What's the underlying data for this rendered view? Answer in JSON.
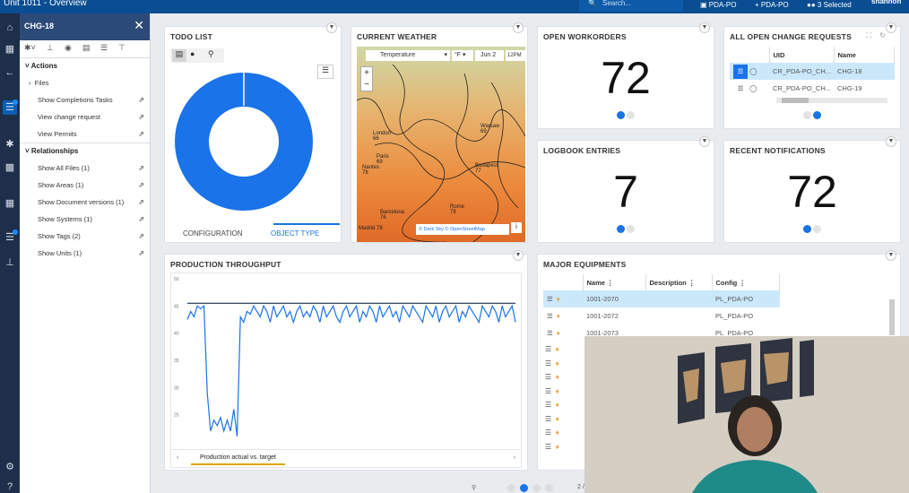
{
  "topbar": {
    "title": "Unit 1011 - Overview",
    "search_placeholder": "Search...",
    "item1": "PDA-PO",
    "item2": "PDA-PO",
    "selected": "3 Selected",
    "user": "shannon"
  },
  "side": {
    "title": "CHG-18",
    "sections": {
      "actions": "Actions",
      "relationships": "Relationships"
    },
    "actions": [
      "Files",
      "Show Completions Tasks",
      "View change request",
      "View Permits"
    ],
    "relationships": [
      "Show All Files (1)",
      "Show Areas (1)",
      "Show Document versions (1)",
      "Show Systems (1)",
      "Show Tags (2)",
      "Show Units (1)"
    ]
  },
  "todo": {
    "title": "TODO LIST",
    "tab_config": "CONFIGURATION",
    "tab_object": "OBJECT TYPE"
  },
  "weather": {
    "title": "CURRENT WEATHER",
    "layer": "Temperature",
    "unit": "°F",
    "date": "Jun 2",
    "time": "12PM",
    "credit1": "© Dark Sky",
    "credit2": "© OpenStreetMap",
    "cities": [
      "London",
      "Paris",
      "Warsaw",
      "Nantes",
      "Budapest",
      "Barcelona",
      "Rome",
      "Madrid"
    ],
    "temps": [
      "66",
      "69",
      "69",
      "78",
      "77",
      "76",
      "79",
      "78"
    ]
  },
  "workorders": {
    "title": "OPEN WORKORDERS",
    "value": "72"
  },
  "logbook": {
    "title": "LOGBOOK ENTRIES",
    "value": "7"
  },
  "notifications": {
    "title": "RECENT NOTIFICATIONS",
    "value": "72"
  },
  "change_requests": {
    "title": "ALL OPEN CHANGE REQUESTS",
    "columns": [
      "UID",
      "Name"
    ],
    "rows": [
      {
        "uid": "CR_PDA-PO_CH...",
        "name": "CHG-18"
      },
      {
        "uid": "CR_PDA-PO_CH...",
        "name": "CHG-19"
      }
    ]
  },
  "throughput": {
    "title": "PRODUCTION THROUGHPUT",
    "tab": "Production actual vs. target",
    "yticks": [
      "50",
      "45",
      "40",
      "35",
      "30",
      "25"
    ]
  },
  "equipments": {
    "title": "MAJOR EQUIPMENTS",
    "columns": [
      "Name",
      "Description",
      "Config"
    ],
    "rows": [
      {
        "name": "1001-2070",
        "desc": "",
        "config": "PL_PDA-PO"
      },
      {
        "name": "1001-2072",
        "desc": "",
        "config": "PL_PDA-PO"
      },
      {
        "name": "1001-2073",
        "desc": "",
        "config": "PL_PDA-PO"
      }
    ]
  },
  "pager": {
    "page": "2 /"
  },
  "colors": {
    "accent": "#1a73e8",
    "topbar": "#0a4d92",
    "panel_header": "#2c4a78",
    "rail": "#1d2f4a",
    "heat": "#e8742c"
  },
  "chart_data": {
    "type": "line",
    "title": "",
    "xlabel": "",
    "ylabel": "",
    "ylim": [
      20,
      50
    ],
    "series": [
      {
        "name": "",
        "values": [
          42.5,
          44,
          43,
          45,
          44.5,
          45,
          29,
          22,
          24,
          23,
          24.5,
          22,
          24,
          22,
          26,
          21,
          43,
          42,
          44,
          43.5,
          45,
          44,
          43,
          45,
          44,
          42,
          45,
          43,
          44,
          45,
          43,
          44,
          42,
          44,
          45,
          43,
          44,
          43,
          45,
          44,
          42,
          45,
          43,
          44,
          45,
          43,
          42,
          44,
          45,
          43,
          44,
          45,
          42,
          44,
          43,
          45,
          44,
          42,
          45,
          43,
          44,
          45,
          43,
          44,
          42,
          45,
          44,
          43,
          45,
          44,
          43,
          42,
          45,
          44,
          43,
          45,
          42,
          44,
          45,
          43,
          44,
          45,
          42,
          44,
          43,
          45,
          44,
          43,
          42,
          45,
          44,
          43,
          45,
          44,
          42,
          45,
          43,
          44,
          45,
          42
        ]
      },
      {
        "name": "",
        "values": [
          45.5,
          45.5
        ]
      }
    ]
  }
}
